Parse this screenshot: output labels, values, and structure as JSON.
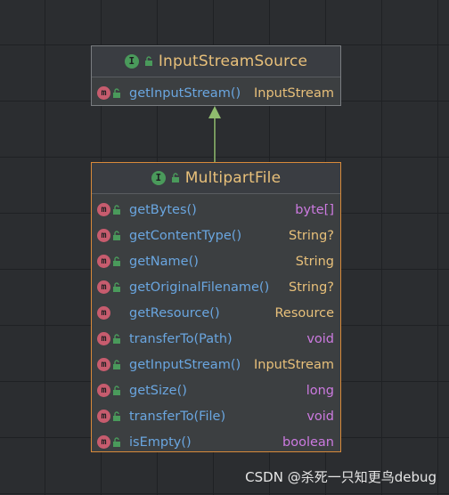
{
  "parent": {
    "name": "InputStreamSource",
    "kind_letter": "I",
    "methods": [
      {
        "name": "getInputStream()",
        "type": "InputStream",
        "public": true
      }
    ]
  },
  "child": {
    "name": "MultipartFile",
    "kind_letter": "I",
    "methods": [
      {
        "name": "getBytes()",
        "type": "byte[]",
        "keyword": true,
        "public": true
      },
      {
        "name": "getContentType()",
        "type": "String?",
        "keyword": false,
        "public": true
      },
      {
        "name": "getName()",
        "type": "String",
        "keyword": false,
        "public": true
      },
      {
        "name": "getOriginalFilename()",
        "type": "String?",
        "keyword": false,
        "public": true
      },
      {
        "name": "getResource()",
        "type": "Resource",
        "keyword": false,
        "public": false
      },
      {
        "name": "transferTo(Path)",
        "type": "void",
        "keyword": true,
        "public": true
      },
      {
        "name": "getInputStream()",
        "type": "InputStream",
        "keyword": false,
        "public": true
      },
      {
        "name": "getSize()",
        "type": "long",
        "keyword": true,
        "public": true
      },
      {
        "name": "transferTo(File)",
        "type": "void",
        "keyword": true,
        "public": true
      },
      {
        "name": "isEmpty()",
        "type": "boolean",
        "keyword": true,
        "public": true
      }
    ]
  },
  "method_letter": "m",
  "watermark": "CSDN @杀死一只知更鸟debug",
  "colors": {
    "background": "#2b2d30",
    "title": "#e8c07a",
    "method_name": "#6aa6e0",
    "keyword_type": "#cc7ae0",
    "arrow": "#8fbc6e",
    "selected_border": "#d88a3a"
  }
}
